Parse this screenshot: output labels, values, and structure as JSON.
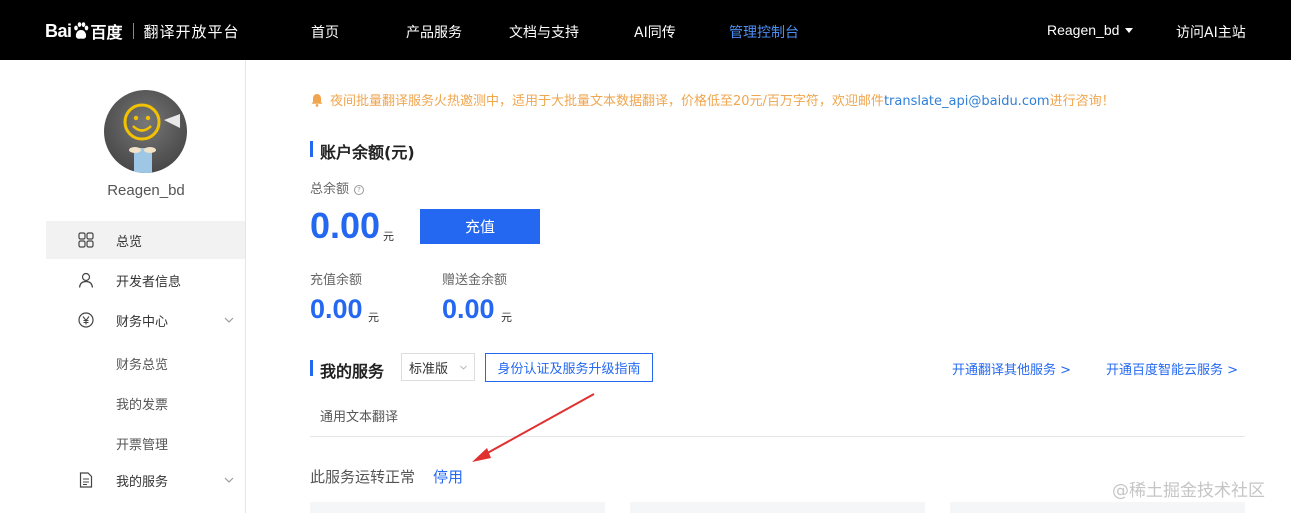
{
  "header": {
    "logo_bai": "Bai",
    "logo_baidu": "百度",
    "platform": "翻译开放平台",
    "nav": [
      {
        "label": "首页"
      },
      {
        "label": "产品服务"
      },
      {
        "label": "文档与支持"
      },
      {
        "label": "AI同传"
      },
      {
        "label": "管理控制台"
      }
    ],
    "user": "Reagen_bd",
    "visit_ai": "访问AI主站"
  },
  "sidebar": {
    "username": "Reagen_bd",
    "items": [
      {
        "label": "总览",
        "icon": "grid-icon"
      },
      {
        "label": "开发者信息",
        "icon": "user-icon"
      },
      {
        "label": "财务中心",
        "icon": "yen-icon"
      },
      {
        "label": "我的服务",
        "icon": "document-icon"
      }
    ],
    "finance_sub": [
      "财务总览",
      "我的发票",
      "开票管理"
    ]
  },
  "main": {
    "notice_text": "夜间批量翻译服务火热邀测中，适用于大批量文本数据翻译，价格低至20元/百万字符，欢迎邮件",
    "notice_email": "translate_api@baidu.com",
    "notice_suffix": "进行咨询！",
    "balance_title": "账户余额(元)",
    "total_label": "总余额",
    "total_value": "0.00",
    "unit": "元",
    "recharge_button": "充值",
    "recharge_balance_label": "充值余额",
    "recharge_balance_value": "0.00",
    "gift_balance_label": "赠送金余额",
    "gift_balance_value": "0.00",
    "services_title": "我的服务",
    "edition_select": "标准版",
    "guide_button": "身份认证及服务升级指南",
    "link_other_services": "开通翻译其他服务 >",
    "link_cloud_services": "开通百度智能云服务 >",
    "tab_general_text": "通用文本翻译",
    "status_text": "此服务运转正常",
    "stop_link": "停用"
  },
  "watermark": "@稀土掘金技术社区",
  "colors": {
    "accent": "#2468f2",
    "notice": "#f0a64e",
    "active_nav": "#4e8ff5",
    "annotation_arrow": "#e03030"
  }
}
